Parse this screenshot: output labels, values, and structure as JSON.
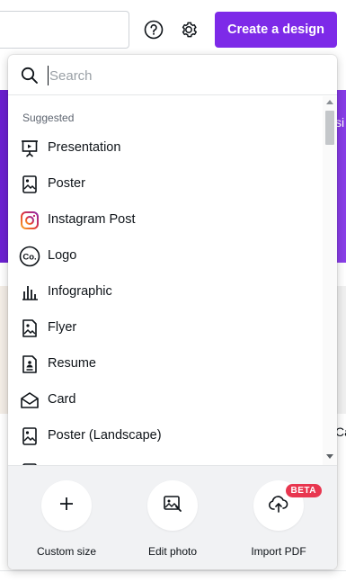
{
  "header": {
    "create_button_label": "Create a design"
  },
  "background": {
    "banner_right_fragment": "si",
    "right_text_fragment": "Ca"
  },
  "search": {
    "placeholder": "Search",
    "value": ""
  },
  "menu": {
    "section_title": "Suggested",
    "items": [
      {
        "label": "Presentation",
        "icon": "presentation-icon"
      },
      {
        "label": "Poster",
        "icon": "poster-icon"
      },
      {
        "label": "Instagram Post",
        "icon": "instagram-icon"
      },
      {
        "label": "Logo",
        "icon": "logo-co-icon"
      },
      {
        "label": "Infographic",
        "icon": "infographic-icon"
      },
      {
        "label": "Flyer",
        "icon": "flyer-icon"
      },
      {
        "label": "Resume",
        "icon": "resume-icon"
      },
      {
        "label": "Card",
        "icon": "card-icon"
      },
      {
        "label": "Poster (Landscape)",
        "icon": "poster-landscape-icon"
      }
    ]
  },
  "actions": [
    {
      "label": "Custom size",
      "icon": "plus-icon"
    },
    {
      "label": "Edit photo",
      "icon": "edit-photo-icon"
    },
    {
      "label": "Import PDF",
      "icon": "upload-cloud-icon",
      "badge": "BETA"
    }
  ],
  "colors": {
    "accent": "#7d2ae8",
    "banner": "#7a2fe0",
    "beta_badge": "#e8364f"
  }
}
